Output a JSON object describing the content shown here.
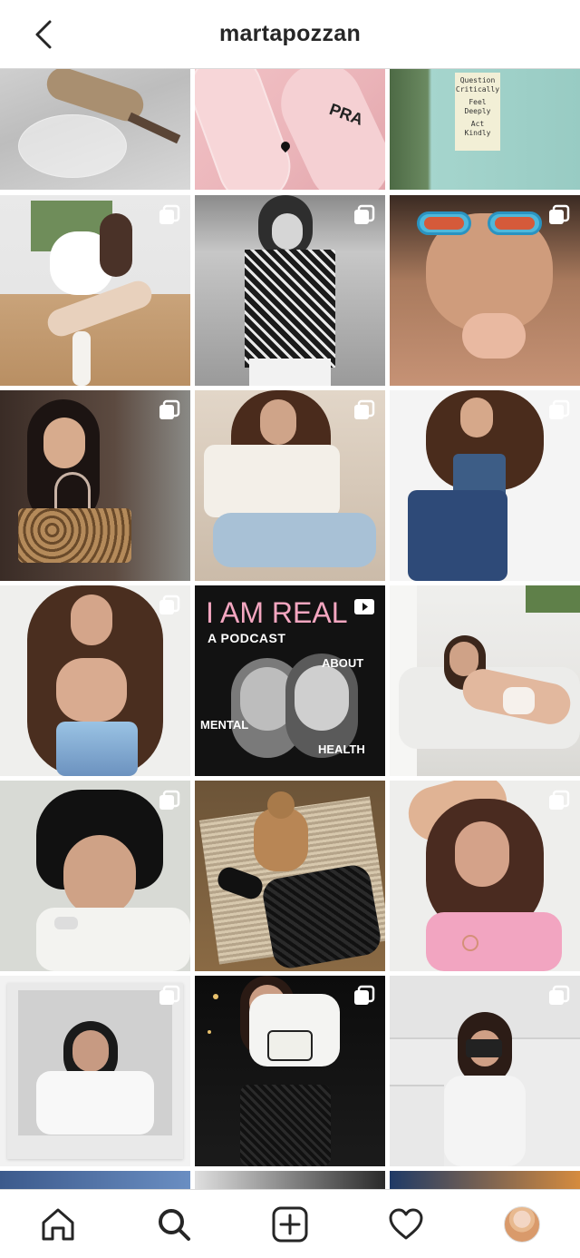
{
  "header": {
    "title": "martapozzan"
  },
  "tile_texts": {
    "sign_lines": [
      "Question",
      "Critically",
      "Feel",
      "Deeply",
      "Act",
      "Kindly"
    ],
    "nail_text": "PRA",
    "podcast": {
      "headline": "I AM REAL",
      "sub": "A PODCAST",
      "w1": "ABOUT",
      "w2": "MENTAL",
      "w3": "HEALTH"
    }
  },
  "icons": {
    "back": "chevron-left-icon",
    "home": "home-icon",
    "search": "search-icon",
    "new_post": "plus-square-icon",
    "activity": "heart-icon",
    "profile": "avatar",
    "carousel": "carousel-icon",
    "video": "video-icon"
  },
  "colors": {
    "border": "#dbdbdb",
    "text": "#262626",
    "podcast_pink": "#f4a6c0"
  }
}
